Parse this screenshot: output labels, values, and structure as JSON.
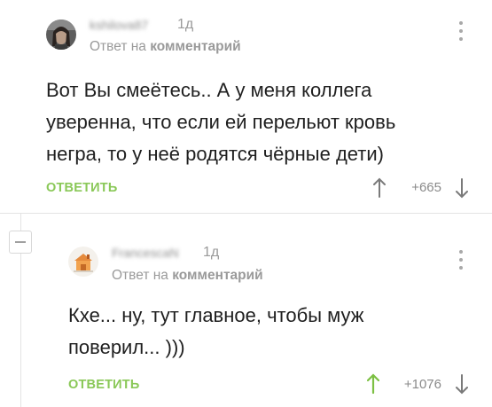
{
  "colors": {
    "accent_green": "#8ac858",
    "muted_text": "#9a9a9a",
    "body_text": "#1f1f1f",
    "icon_gray": "#a8a8a8",
    "divider": "#e3e3e3"
  },
  "comments": [
    {
      "username": "kshilova87",
      "time": "1д",
      "reply_prefix": "Ответ на",
      "reply_target": "комментарий",
      "text": "Вот Вы смеётесь.. А у меня коллега\nуверенна, что если ей перельют кровь\nнегра, то у неё родятся чёрные дети)",
      "reply_label": "ОТВЕТИТЬ",
      "rating": "+665",
      "icons": {
        "menu": "kebab-menu-icon",
        "up": "arrow-up-icon",
        "down": "arrow-down-icon"
      }
    },
    {
      "username": "FrancescaN",
      "time": "1д",
      "reply_prefix": "Ответ на",
      "reply_target": "комментарий",
      "text": "Кхе... ну, тут главное, чтобы муж\nповерил... )))",
      "reply_label": "ОТВЕТИТЬ",
      "rating": "+1076",
      "icons": {
        "menu": "kebab-menu-icon",
        "up": "arrow-up-icon",
        "down": "arrow-down-icon"
      }
    }
  ],
  "thread": {
    "collapse_icon": "minus-icon"
  }
}
